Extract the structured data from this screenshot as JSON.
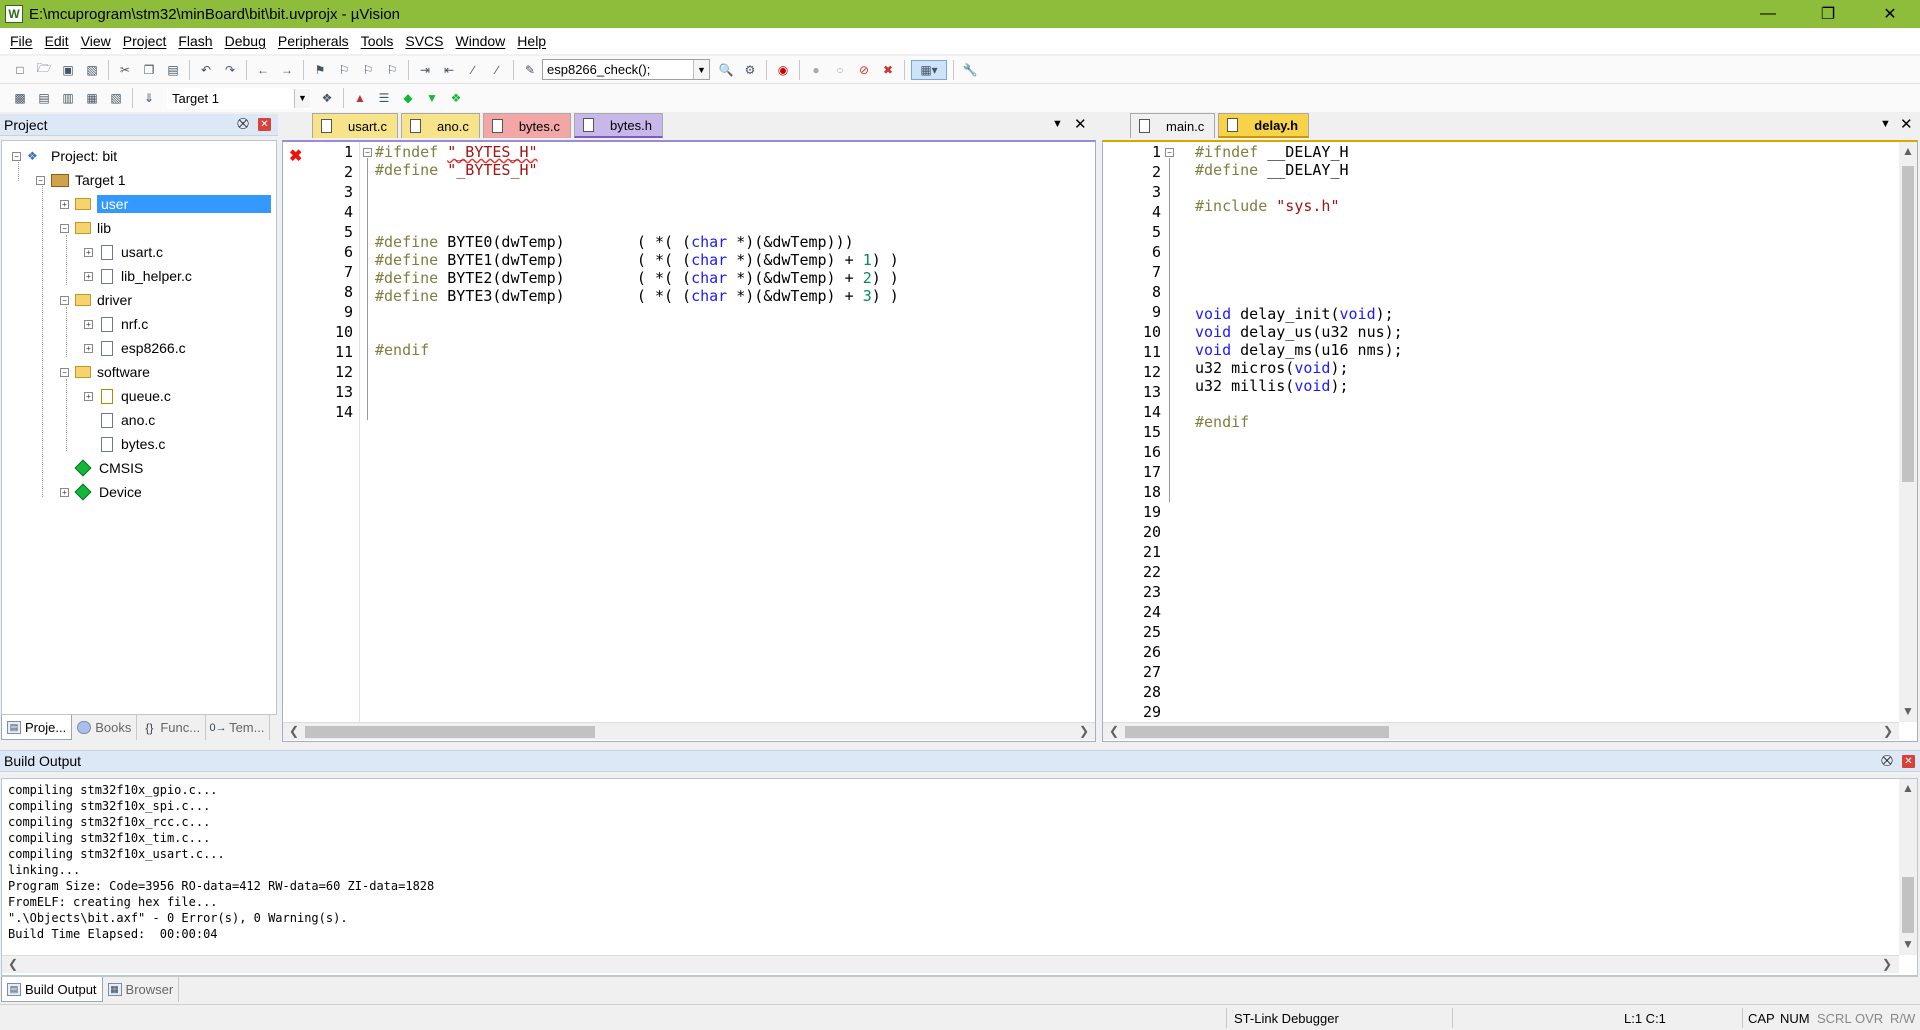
{
  "window": {
    "title": "E:\\mcuprogram\\stm32\\minBoard\\bit\\bit.uvprojx - µVision",
    "app_icon": "W"
  },
  "menu": [
    "File",
    "Edit",
    "View",
    "Project",
    "Flash",
    "Debug",
    "Peripherals",
    "Tools",
    "SVCS",
    "Window",
    "Help"
  ],
  "toolbar": {
    "find_combo": "esp8266_check();",
    "target_combo": "Target 1"
  },
  "project_panel": {
    "title": "Project",
    "tree": [
      {
        "label": "Project: bit"
      },
      {
        "label": "Target 1"
      },
      {
        "label": "user"
      },
      {
        "label": "lib"
      },
      {
        "label": "usart.c"
      },
      {
        "label": "lib_helper.c"
      },
      {
        "label": "driver"
      },
      {
        "label": "nrf.c"
      },
      {
        "label": "esp8266.c"
      },
      {
        "label": "software"
      },
      {
        "label": "queue.c"
      },
      {
        "label": "ano.c"
      },
      {
        "label": "bytes.c"
      },
      {
        "label": "CMSIS"
      },
      {
        "label": "Device"
      }
    ],
    "tabs": [
      "Proje...",
      "Books",
      "Func...",
      "Tem..."
    ]
  },
  "editor_left": {
    "tabs": [
      {
        "label": "usart.c",
        "color": "#f7e38a"
      },
      {
        "label": "ano.c",
        "color": "#f7e38a"
      },
      {
        "label": "bytes.c",
        "color": "#f2a6a6"
      },
      {
        "label": "bytes.h",
        "color": "#c8b8ea"
      }
    ],
    "line_numbers": [
      "1",
      "2",
      "3",
      "4",
      "5",
      "6",
      "7",
      "8",
      "9",
      "10",
      "11",
      "12",
      "13",
      "14"
    ]
  },
  "editor_right": {
    "tabs": [
      {
        "label": "main.c",
        "color": "#f0f0f0"
      },
      {
        "label": "delay.h",
        "color": "#f7d34a"
      }
    ],
    "line_numbers": [
      "1",
      "2",
      "3",
      "4",
      "5",
      "6",
      "7",
      "8",
      "9",
      "10",
      "11",
      "12",
      "13",
      "14",
      "15",
      "16",
      "17",
      "18",
      "19",
      "20",
      "21",
      "22",
      "23",
      "24",
      "25",
      "26",
      "27",
      "28",
      "29"
    ]
  },
  "build_output": {
    "title": "Build Output",
    "lines": [
      "compiling stm32f10x_gpio.c...",
      "compiling stm32f10x_spi.c...",
      "compiling stm32f10x_rcc.c...",
      "compiling stm32f10x_tim.c...",
      "compiling stm32f10x_usart.c...",
      "linking...",
      "Program Size: Code=3956 RO-data=412 RW-data=60 ZI-data=1828",
      "FromELF: creating hex file...",
      "\".\\Objects\\bit.axf\" - 0 Error(s), 0 Warning(s).",
      "Build Time Elapsed:  00:00:04"
    ],
    "tabs": [
      "Build Output",
      "Browser"
    ]
  },
  "status": {
    "debugger": "ST-Link Debugger",
    "position": "L:1 C:1",
    "cap": "CAP",
    "num": "NUM",
    "scrl": "SCRL",
    "ovr": "OVR",
    "rw": "R/W"
  }
}
